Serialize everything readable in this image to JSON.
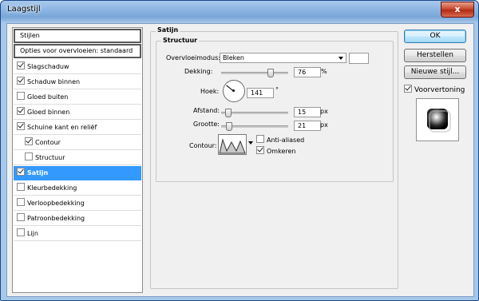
{
  "window": {
    "title": "Laagstijl",
    "close_glyph": "x"
  },
  "sidebar": {
    "items": [
      {
        "label": "Stijlen",
        "checkbox": false
      },
      {
        "label": "Opties voor overvloeien: standaard",
        "checkbox": false
      },
      {
        "label": "Slagschaduw",
        "checkbox": true,
        "checked": true
      },
      {
        "label": "Schaduw binnen",
        "checkbox": true,
        "checked": true
      },
      {
        "label": "Gloed buiten",
        "checkbox": true,
        "checked": false
      },
      {
        "label": "Gloed binnen",
        "checkbox": true,
        "checked": true
      },
      {
        "label": "Schuine kant en reliëf",
        "checkbox": true,
        "checked": true
      },
      {
        "label": "Contour",
        "checkbox": true,
        "checked": true
      },
      {
        "label": "Structuur",
        "checkbox": true,
        "checked": false
      },
      {
        "label": "Satijn",
        "checkbox": true,
        "checked": true,
        "selected": true
      },
      {
        "label": "Kleurbedekking",
        "checkbox": true,
        "checked": false
      },
      {
        "label": "Verloopbedekking",
        "checkbox": true,
        "checked": false
      },
      {
        "label": "Patroonbedekking",
        "checkbox": true,
        "checked": false
      },
      {
        "label": "Lijn",
        "checkbox": true,
        "checked": false
      }
    ]
  },
  "satin": {
    "group_title": "Satijn",
    "structure_title": "Structuur",
    "blend_mode_label": "Overvloeimodus:",
    "blend_mode_value": "Bleken",
    "opacity_label": "Dekking:",
    "opacity_value": "76",
    "opacity_unit": "%",
    "opacity_fraction": 0.76,
    "angle_label": "Hoek:",
    "angle_value": "141",
    "angle_unit": "°",
    "angle_degrees": 141,
    "distance_label": "Afstand:",
    "distance_value": "15",
    "distance_unit": "px",
    "distance_fraction": 0.06,
    "size_label": "Grootte:",
    "size_value": "21",
    "size_unit": "px",
    "size_fraction": 0.08,
    "contour_label": "Contour:",
    "anti_aliased_label": "Anti-aliased",
    "anti_aliased_checked": false,
    "invert_label": "Omkeren",
    "invert_checked": true
  },
  "buttons": {
    "ok": "OK",
    "reset": "Herstellen",
    "new_style": "Nieuwe stijl...",
    "preview_label": "Voorvertoning",
    "preview_checked": true
  }
}
